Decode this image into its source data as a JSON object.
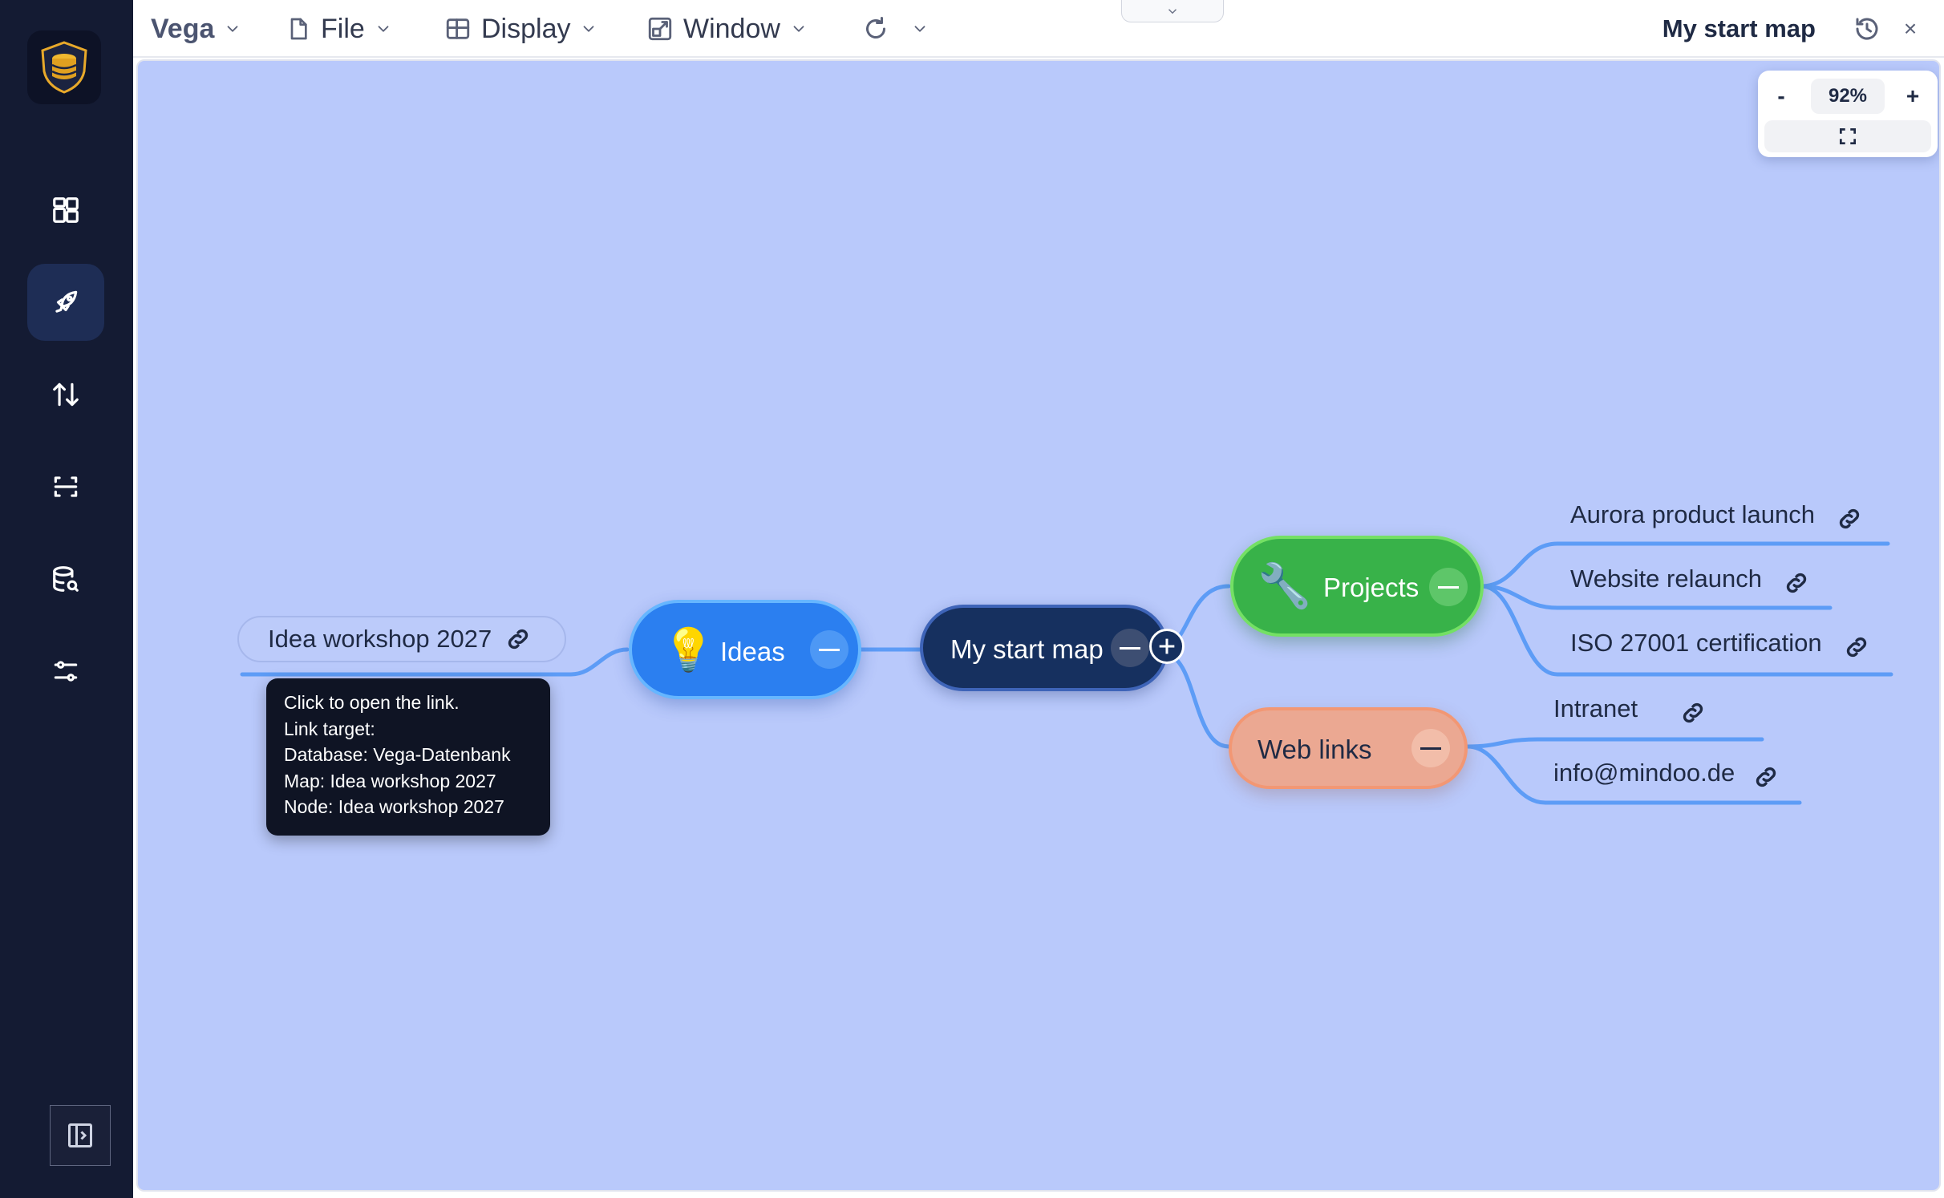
{
  "sidebar": {
    "items": [
      {
        "icon": "dashboard-icon"
      },
      {
        "icon": "rocket-icon",
        "active": true
      },
      {
        "icon": "sort-arrows-icon"
      },
      {
        "icon": "scan-frame-icon"
      },
      {
        "icon": "database-search-icon"
      },
      {
        "icon": "sliders-icon"
      }
    ],
    "collapse_icon": "sidebar-toggle-icon"
  },
  "topbar": {
    "brand": "Vega",
    "menus": [
      {
        "label": "File",
        "icon": "file-icon"
      },
      {
        "label": "Display",
        "icon": "layout-grid-icon"
      },
      {
        "label": "Window",
        "icon": "window-expand-icon"
      }
    ],
    "refresh_icon": "refresh-icon",
    "map_title": "My start map",
    "close_label": "×"
  },
  "zoom": {
    "minus": "-",
    "value": "92%",
    "plus": "+"
  },
  "map": {
    "root": {
      "label": "My start map",
      "color": "#16305f"
    },
    "ideas": {
      "label": "Ideas",
      "emoji": "💡",
      "color": "#2b7ff0"
    },
    "projects": {
      "label": "Projects",
      "emoji": "🔧",
      "color": "#38b249"
    },
    "weblinks": {
      "label": "Web links",
      "color": "#eba892"
    },
    "idea_leaf": "Idea workshop 2027",
    "project_leaves": [
      "Aurora product launch",
      "Website relaunch",
      "ISO 27001 certification"
    ],
    "web_leaves": [
      "Intranet",
      "info@mindoo.de"
    ]
  },
  "tooltip": {
    "lines": [
      "Click to open the link.",
      "Link target:",
      "Database: Vega-Datenbank",
      "Map: Idea workshop 2027",
      "Node: Idea workshop 2027"
    ]
  }
}
